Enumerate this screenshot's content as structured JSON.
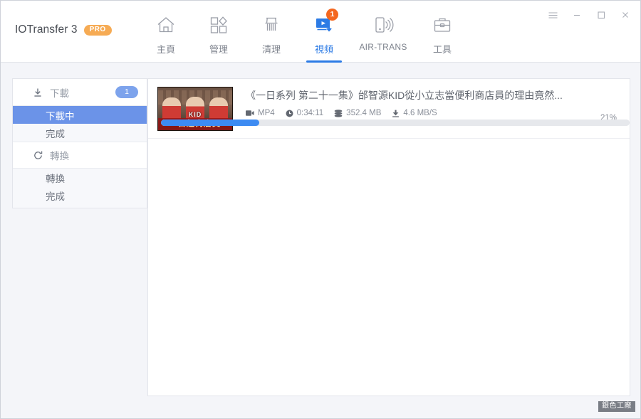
{
  "window": {
    "app_title": "IOTransfer 3",
    "pro_badge": "PRO",
    "controls": {
      "menu": "menu-icon",
      "minimize": "minimize-icon",
      "maximize": "maximize-icon",
      "close": "close-icon"
    }
  },
  "nav": {
    "items": [
      {
        "label": "主頁",
        "icon": "home-icon",
        "active": false,
        "badge": null
      },
      {
        "label": "管理",
        "icon": "manage-icon",
        "active": false,
        "badge": null
      },
      {
        "label": "清理",
        "icon": "clean-icon",
        "active": false,
        "badge": null
      },
      {
        "label": "視頻",
        "icon": "video-icon",
        "active": true,
        "badge": "1"
      },
      {
        "label": "AIR-TRANS",
        "icon": "air-trans-icon",
        "active": false,
        "badge": null
      },
      {
        "label": "工具",
        "icon": "toolbox-icon",
        "active": false,
        "badge": null
      }
    ]
  },
  "sidebar": {
    "groups": [
      {
        "label": "下載",
        "icon": "download-icon",
        "badge": "1",
        "items": [
          {
            "label": "下載中",
            "selected": true
          },
          {
            "label": "完成",
            "selected": false
          }
        ]
      },
      {
        "label": "轉換",
        "icon": "refresh-icon",
        "badge": null,
        "items": [
          {
            "label": "轉換",
            "selected": false
          },
          {
            "label": "完成",
            "selected": false
          }
        ]
      }
    ]
  },
  "downloads": [
    {
      "title": "《一日系列 第二十一集》邰智源KID從小立志當便利商店員的理由竟然...",
      "format": "MP4",
      "duration": "0:34:11",
      "size": "352.4 MB",
      "speed": "4.6 MB/S",
      "progress_label": "21%",
      "progress_value": 21,
      "thumbnail_caption": "一日超商店員",
      "thumbnail_overlay": "KID"
    }
  ],
  "watermark": {
    "text": "銀色工廠"
  },
  "colors": {
    "accent_blue": "#2c7be5",
    "progress_blue": "#3d8bf2",
    "select_blue": "#6b93e8",
    "badge_blue": "#7da3ec",
    "pro_orange": "#f6ab54",
    "badge_orange": "#f4671f",
    "panel_bg": "#f4f5f9"
  }
}
